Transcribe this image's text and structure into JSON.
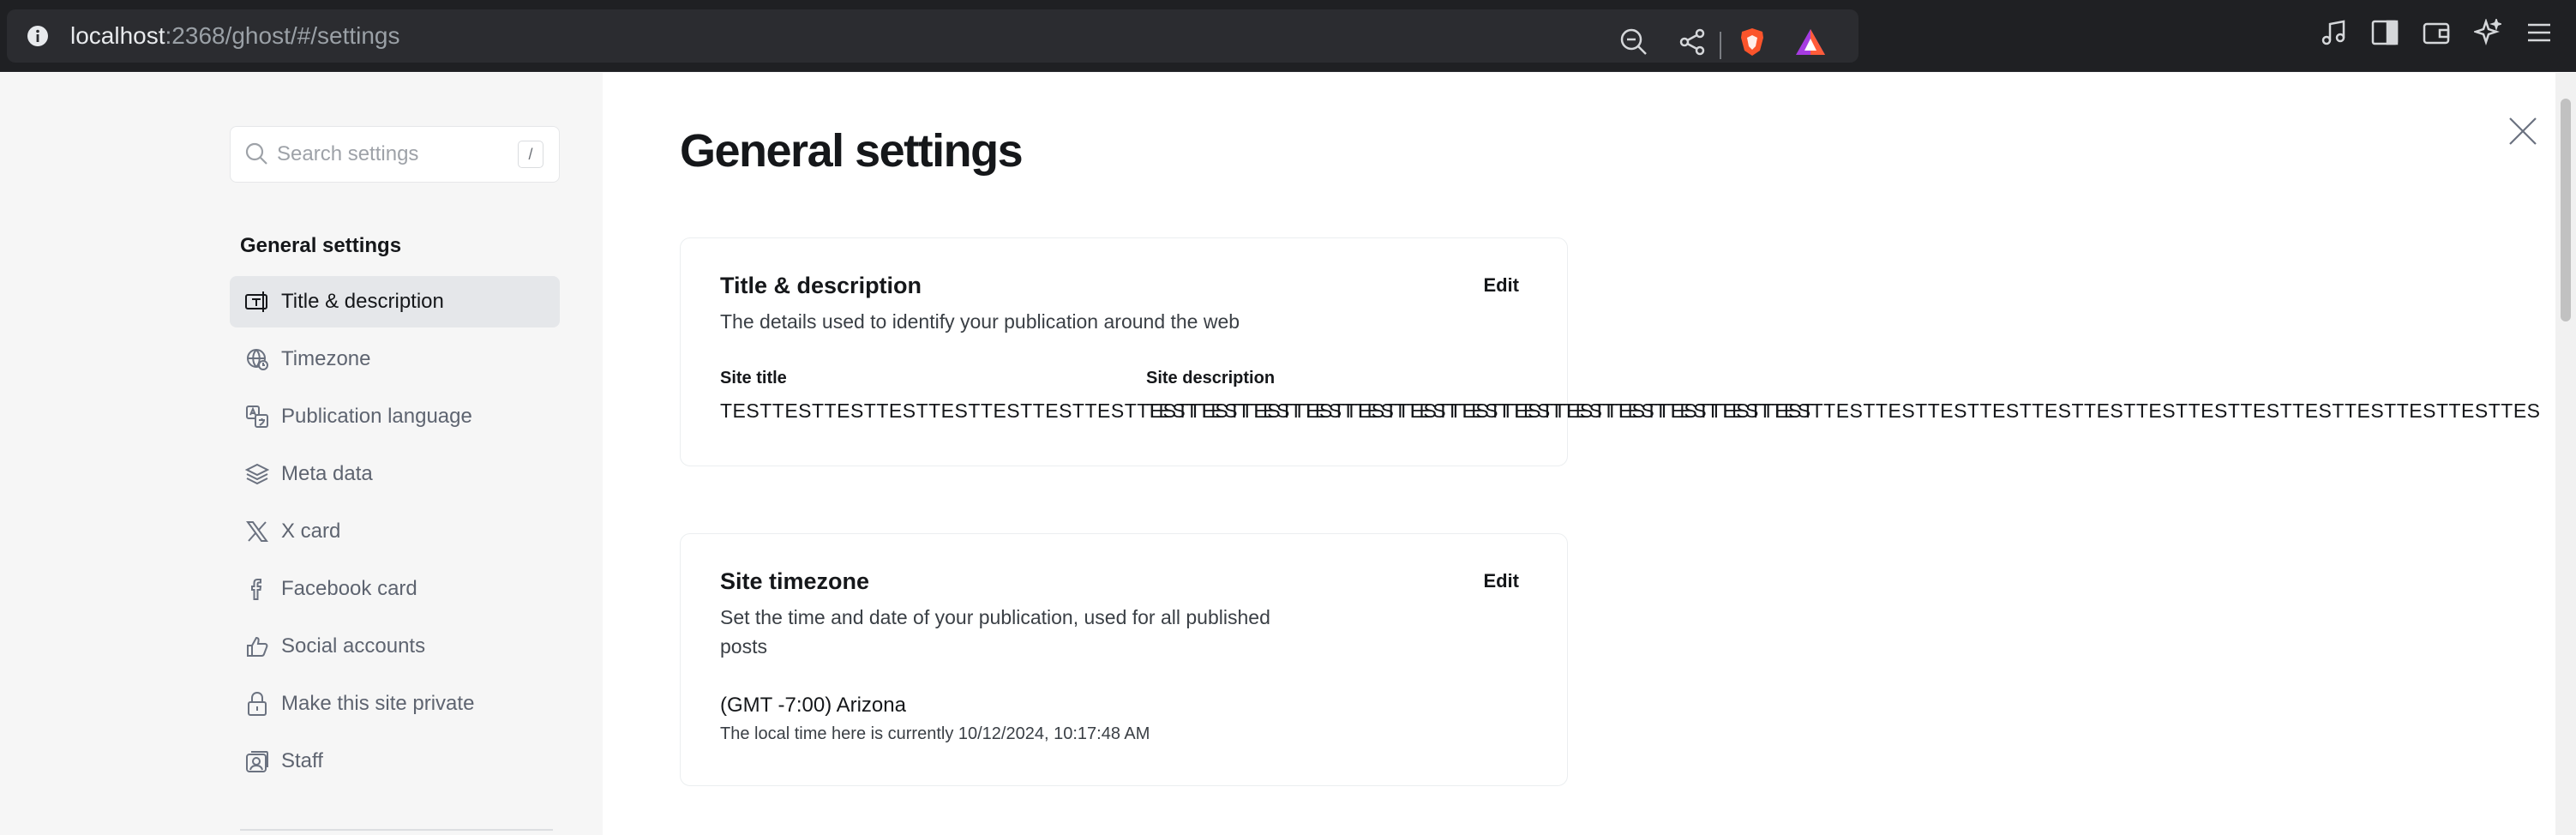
{
  "browser": {
    "url_host": "localhost",
    "url_rest": ":2368/ghost/#/settings",
    "icons": [
      "info-icon",
      "zoom-out-icon",
      "share-icon",
      "brave-shield-icon",
      "brave-rewards-icon",
      "media-icon",
      "sidebar-icon",
      "wallet-icon",
      "leo-ai-icon",
      "menu-icon"
    ]
  },
  "sidebar": {
    "search_placeholder": "Search settings",
    "search_shortcut": "/",
    "heading": "General settings",
    "items": [
      {
        "label": "Title & description",
        "icon": "title-description-icon",
        "active": true
      },
      {
        "label": "Timezone",
        "icon": "timezone-icon",
        "active": false
      },
      {
        "label": "Publication language",
        "icon": "language-icon",
        "active": false
      },
      {
        "label": "Meta data",
        "icon": "layers-icon",
        "active": false
      },
      {
        "label": "X card",
        "icon": "x-icon",
        "active": false
      },
      {
        "label": "Facebook card",
        "icon": "facebook-icon",
        "active": false
      },
      {
        "label": "Social accounts",
        "icon": "thumbs-up-icon",
        "active": false
      },
      {
        "label": "Make this site private",
        "icon": "lock-icon",
        "active": false
      },
      {
        "label": "Staff",
        "icon": "staff-icon",
        "active": false
      }
    ]
  },
  "main": {
    "title": "General settings",
    "cards": {
      "title_description": {
        "title": "Title & description",
        "description": "The details used to identify your publication around the web",
        "edit_label": "Edit",
        "site_title_label": "Site title",
        "site_title_value": "TESTTESTTESTTESTTESTTESTTESTTESTTESTTESTTESTTESTTESTTESTTESTTESTTESTTESTTESTTESTTEST",
        "site_description_label": "Site description",
        "site_description_value": "TESTTESTTESTTESTTESTTESTTESTTESTTESTTESTTESTTESTTESTTESTTESTTESTTESTTESTTESTTESTTESTTESTTESTTESTTESTTESTTES"
      },
      "timezone": {
        "title": "Site timezone",
        "description": "Set the time and date of your publication, used for all published posts",
        "edit_label": "Edit",
        "value": "(GMT -7:00) Arizona",
        "local_time": "The local time here is currently 10/12/2024, 10:17:48 AM"
      }
    }
  },
  "colors": {
    "sidebar_bg": "#f6f6f6",
    "active_item_bg": "#e5e7ea",
    "chrome_bg": "#1f2023",
    "brave_orange": "#fb542b"
  }
}
